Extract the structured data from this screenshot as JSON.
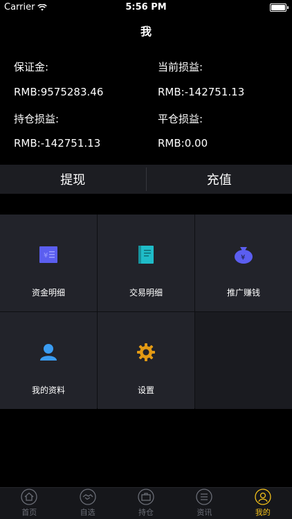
{
  "status_bar": {
    "carrier": "Carrier",
    "time": "5:56 PM"
  },
  "nav": {
    "title": "我"
  },
  "account": {
    "margin_label": "保证金:",
    "margin_value": "RMB:9575283.46",
    "current_pl_label": "当前损益:",
    "current_pl_value": "RMB:-142751.13",
    "position_pl_label": "持仓损益:",
    "position_pl_value": "RMB:-142751.13",
    "close_pl_label": "平仓损益:",
    "close_pl_value": "RMB:0.00"
  },
  "actions": {
    "withdraw": "提现",
    "deposit": "充值"
  },
  "menu": [
    {
      "label": "资金明细",
      "icon": "fund-detail-icon",
      "color": "#5b5ef0"
    },
    {
      "label": "交易明细",
      "icon": "trade-detail-icon",
      "color": "#1fbcc8"
    },
    {
      "label": "推广赚钱",
      "icon": "money-bag-icon",
      "color": "#5b5ef0"
    },
    {
      "label": "我的资料",
      "icon": "profile-icon",
      "color": "#3a9cf2"
    },
    {
      "label": "设置",
      "icon": "gear-icon",
      "color": "#e39a14"
    }
  ],
  "tabs": [
    {
      "label": "首页",
      "icon": "home-icon"
    },
    {
      "label": "自选",
      "icon": "handshake-icon"
    },
    {
      "label": "持仓",
      "icon": "briefcase-icon"
    },
    {
      "label": "资讯",
      "icon": "news-icon"
    },
    {
      "label": "我的",
      "icon": "user-icon",
      "active": true
    }
  ],
  "colors": {
    "accent": "#f2c01a",
    "inactive_tab": "#6b6e77"
  }
}
